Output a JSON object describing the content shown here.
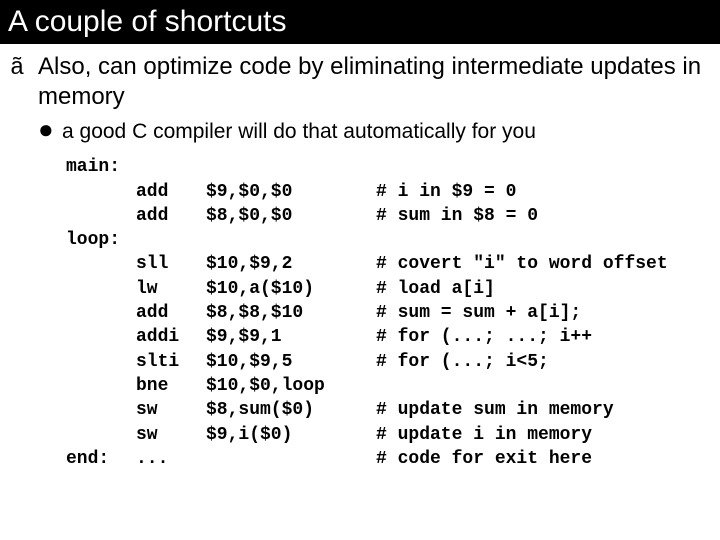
{
  "title": "A couple of shortcuts",
  "bullet1_marker": "ã",
  "bullet1_text": "Also, can optimize code by eliminating intermediate updates in memory",
  "bullet2_marker": "●",
  "bullet2_text": "a good C compiler will do that automatically for you",
  "code": [
    {
      "label": "main:",
      "op": "",
      "args": "",
      "cmt": ""
    },
    {
      "label": "",
      "op": "add",
      "args": "$9,$0,$0",
      "cmt": "# i in $9 = 0"
    },
    {
      "label": "",
      "op": "add",
      "args": "$8,$0,$0",
      "cmt": "# sum in $8 = 0"
    },
    {
      "label": "loop:",
      "op": "",
      "args": "",
      "cmt": ""
    },
    {
      "label": "",
      "op": "sll",
      "args": "$10,$9,2",
      "cmt": "# covert \"i\" to word offset"
    },
    {
      "label": "",
      "op": "lw",
      "args": "$10,a($10)",
      "cmt": "# load a[i]"
    },
    {
      "label": "",
      "op": "add",
      "args": "$8,$8,$10",
      "cmt": "# sum = sum + a[i];"
    },
    {
      "label": "",
      "op": "addi",
      "args": "$9,$9,1",
      "cmt": "# for (...; ...; i++"
    },
    {
      "label": "",
      "op": "slti",
      "args": "$10,$9,5",
      "cmt": "# for (...; i<5;"
    },
    {
      "label": "",
      "op": "bne",
      "args": "$10,$0,loop",
      "cmt": ""
    },
    {
      "label": "",
      "op": "sw",
      "args": "$8,sum($0)",
      "cmt": "# update sum in memory"
    },
    {
      "label": "",
      "op": "sw",
      "args": "$9,i($0)",
      "cmt": "# update i in memory"
    },
    {
      "label": "end:",
      "op": "...",
      "args": "",
      "cmt": "# code for exit here"
    }
  ]
}
